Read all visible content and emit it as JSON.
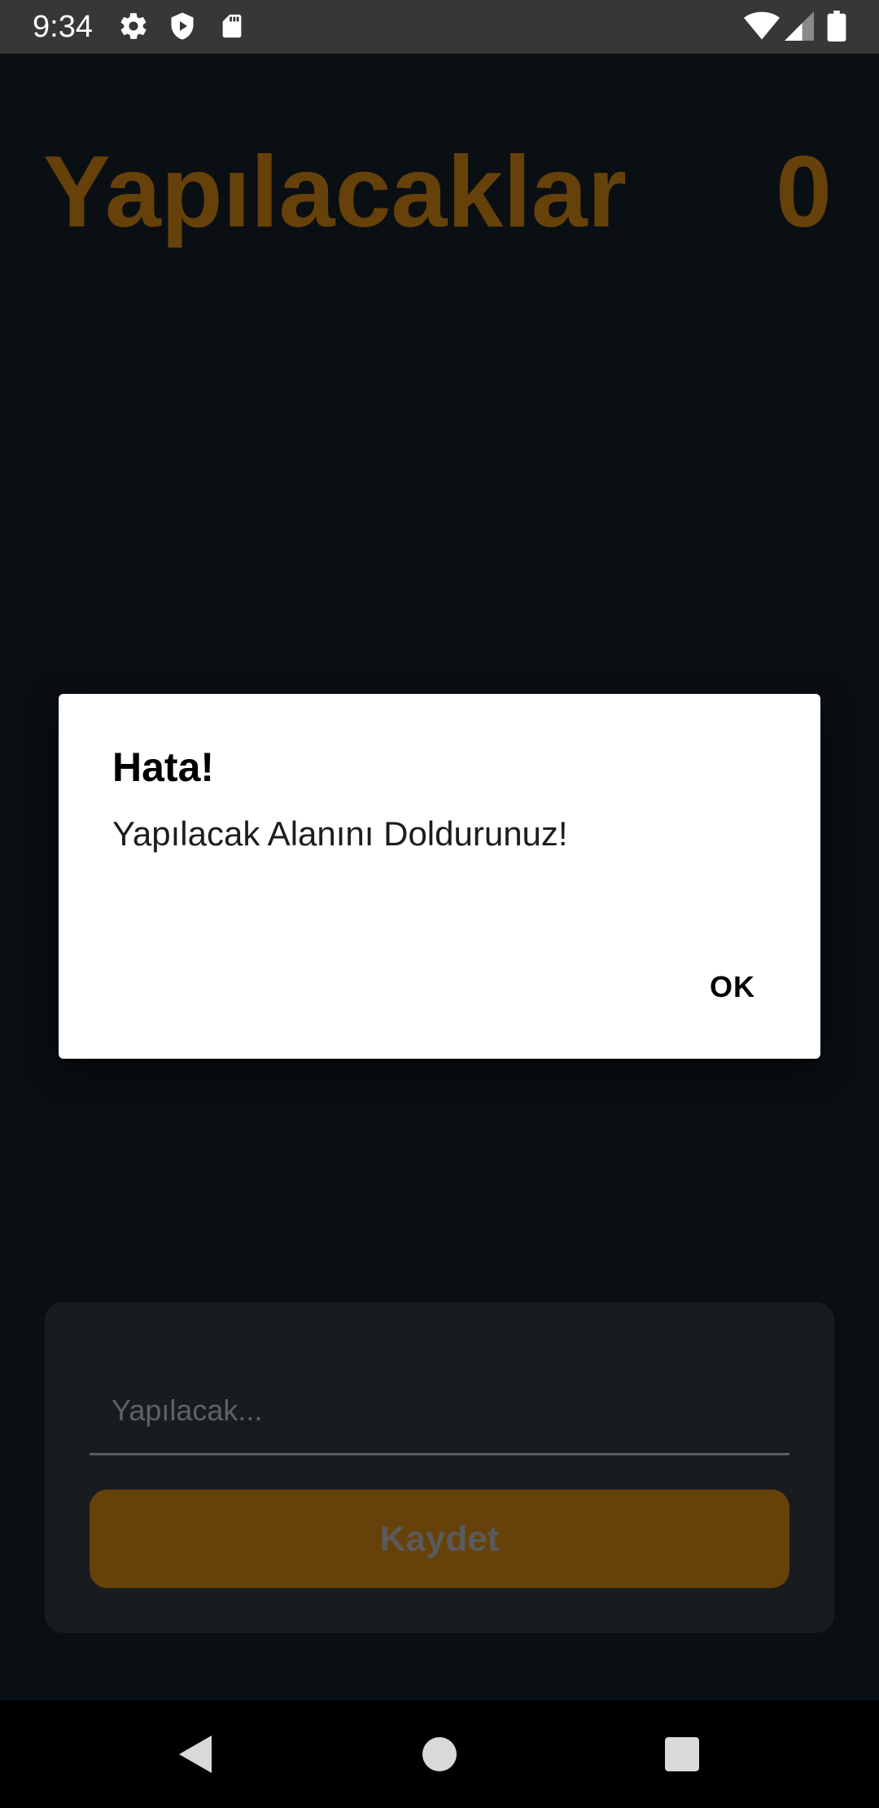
{
  "status_bar": {
    "time": "9:34",
    "icons": [
      "gear-icon",
      "shield-play-icon",
      "sd-card-icon",
      "wifi-icon",
      "signal-icon",
      "battery-icon"
    ]
  },
  "app": {
    "title": "Yapılacaklar",
    "count": "0",
    "accent_color": "#66410a"
  },
  "form": {
    "input_placeholder": "Yapılacak...",
    "input_value": "",
    "save_label": "Kaydet"
  },
  "dialog": {
    "title": "Hata!",
    "message": "Yapılacak Alanını Doldurunuz!",
    "ok_label": "OK"
  },
  "nav_bar": {
    "icons": [
      "back-icon",
      "home-icon",
      "recents-icon"
    ]
  }
}
